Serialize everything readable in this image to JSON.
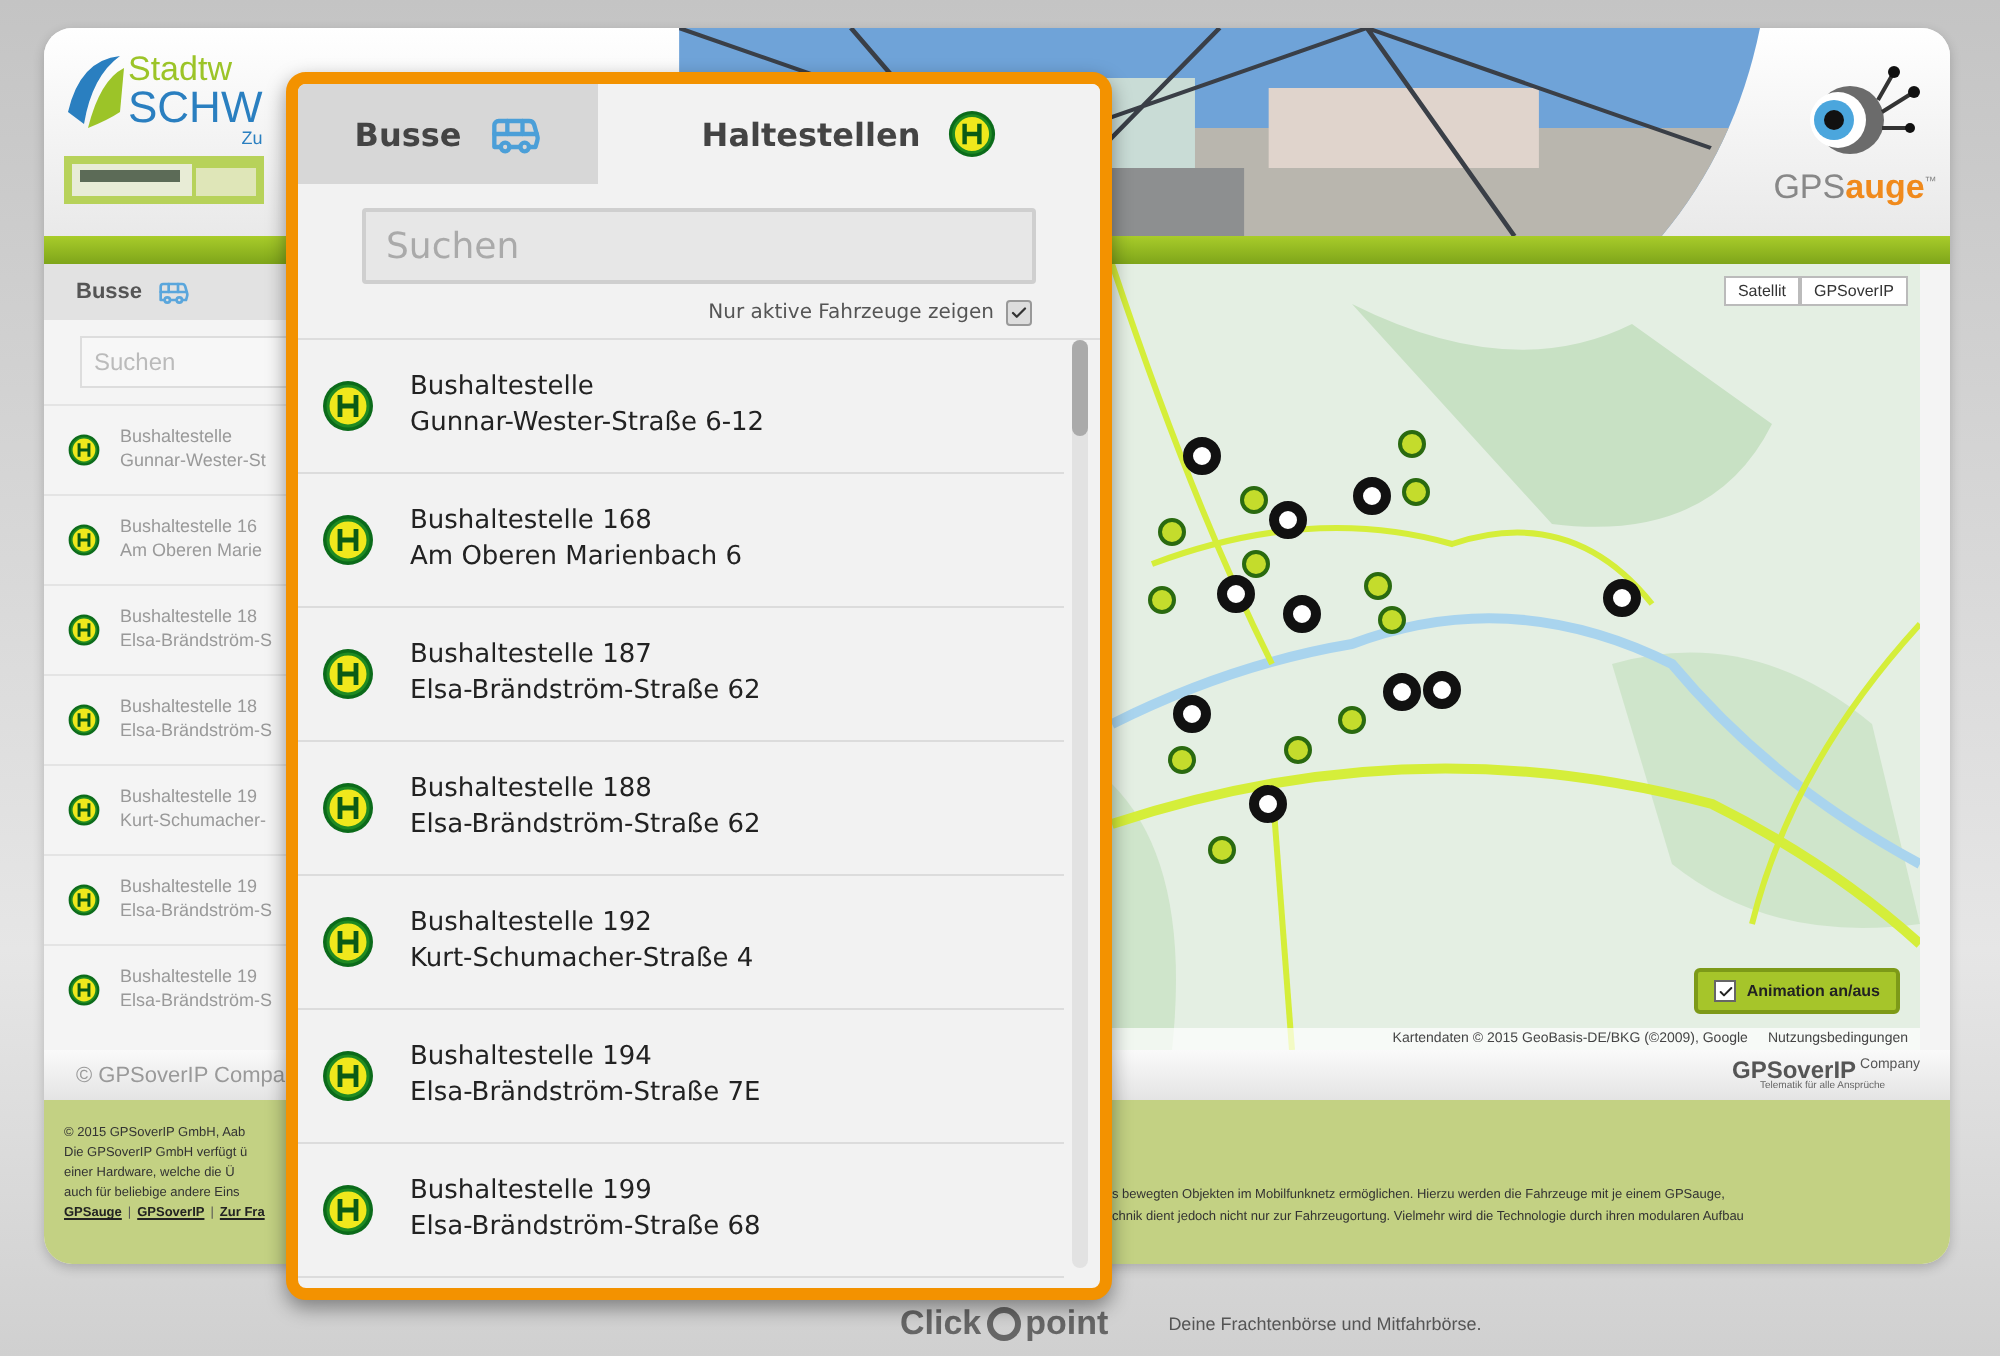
{
  "header": {
    "logo_lines": [
      "Stadtw",
      "SCHW",
      "Zu"
    ],
    "brand": {
      "name_a": "GPS",
      "name_b": "auge",
      "trademark": "™"
    }
  },
  "sidebar": {
    "tab": "Busse",
    "search_placeholder": "Suchen",
    "stops": [
      {
        "line1": "Bushaltestelle",
        "line2": "Gunnar-Wester-St"
      },
      {
        "line1": "Bushaltestelle 16",
        "line2": "Am Oberen Marie"
      },
      {
        "line1": "Bushaltestelle 18",
        "line2": "Elsa-Brändström-S"
      },
      {
        "line1": "Bushaltestelle 18",
        "line2": "Elsa-Brändström-S"
      },
      {
        "line1": "Bushaltestelle 19",
        "line2": "Kurt-Schumacher-"
      },
      {
        "line1": "Bushaltestelle 19",
        "line2": "Elsa-Brändström-S"
      },
      {
        "line1": "Bushaltestelle 19",
        "line2": "Elsa-Brändström-S"
      }
    ]
  },
  "map": {
    "buttons": [
      {
        "label": "Satellit"
      },
      {
        "label": "GPSoverIP"
      }
    ],
    "animation": {
      "label": "Animation an/aus",
      "checked": true
    },
    "attribution": "Kartendaten © 2015 GeoBasis-DE/BKG (©2009), Google",
    "terms": "Nutzungsbedingungen"
  },
  "footer_bar": {
    "left": "© GPSoverIP Compa",
    "brand": "GPSoverIP",
    "brand_suffix": "Company",
    "tagline": "Telematik für alle Ansprüche"
  },
  "footer": {
    "left_lines": [
      "© 2015 GPSoverIP GmbH, Aab",
      "Die GPSoverIP GmbH verfügt ü",
      "einer Hardware, welche die Ü",
      "auch für beliebige andere Eins"
    ],
    "links": [
      "GPSauge",
      "GPSoverIP",
      "Zur Fra"
    ],
    "separators": [
      "|",
      "|"
    ],
    "right_lines": [
      "s bewegten Objekten im Mobilfunknetz ermöglichen. Hierzu werden die Fahrzeuge mit je einem GPSauge,",
      "chnik dient jedoch nicht nur zur Fahrzeugortung. Vielmehr wird die Technologie durch ihren modularen Aufbau"
    ]
  },
  "below": {
    "logo_a": "Click",
    "logo_b": "point",
    "tagline": "Deine Frachtenbörse und Mitfahrbörse."
  },
  "panel": {
    "tabs": [
      {
        "label": "Busse",
        "kind": "bus",
        "selected": false
      },
      {
        "label": "Haltestellen",
        "kind": "stop",
        "selected": true
      }
    ],
    "search": {
      "placeholder": "Suchen"
    },
    "filter": {
      "label": "Nur aktive Fahrzeuge zeigen",
      "checked": true
    },
    "stops": [
      {
        "line1": "Bushaltestelle",
        "line2": "Gunnar-Wester-Straße 6-12"
      },
      {
        "line1": "Bushaltestelle 168",
        "line2": "Am Oberen Marienbach 6"
      },
      {
        "line1": "Bushaltestelle 187",
        "line2": "Elsa-Brändström-Straße 62"
      },
      {
        "line1": "Bushaltestelle 188",
        "line2": "Elsa-Brändström-Straße 62"
      },
      {
        "line1": "Bushaltestelle 192",
        "line2": "Kurt-Schumacher-Straße 4"
      },
      {
        "line1": "Bushaltestelle 194",
        "line2": "Elsa-Brändström-Straße 7E"
      },
      {
        "line1": "Bushaltestelle 199",
        "line2": "Elsa-Brändström-Straße 68"
      }
    ]
  }
}
